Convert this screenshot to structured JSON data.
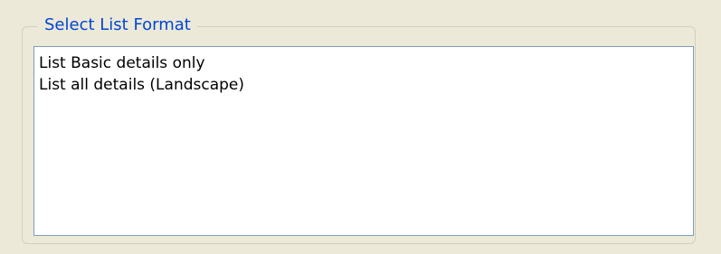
{
  "group": {
    "title": "Select List Format"
  },
  "list": {
    "items": [
      {
        "label": "List Basic details only"
      },
      {
        "label": "List all details (Landscape)"
      }
    ]
  },
  "colors": {
    "background": "#ece9d8",
    "legend_text": "#0046d5",
    "group_border": "#d0d0bf",
    "list_border": "#7f9db9",
    "list_background": "#ffffff"
  }
}
